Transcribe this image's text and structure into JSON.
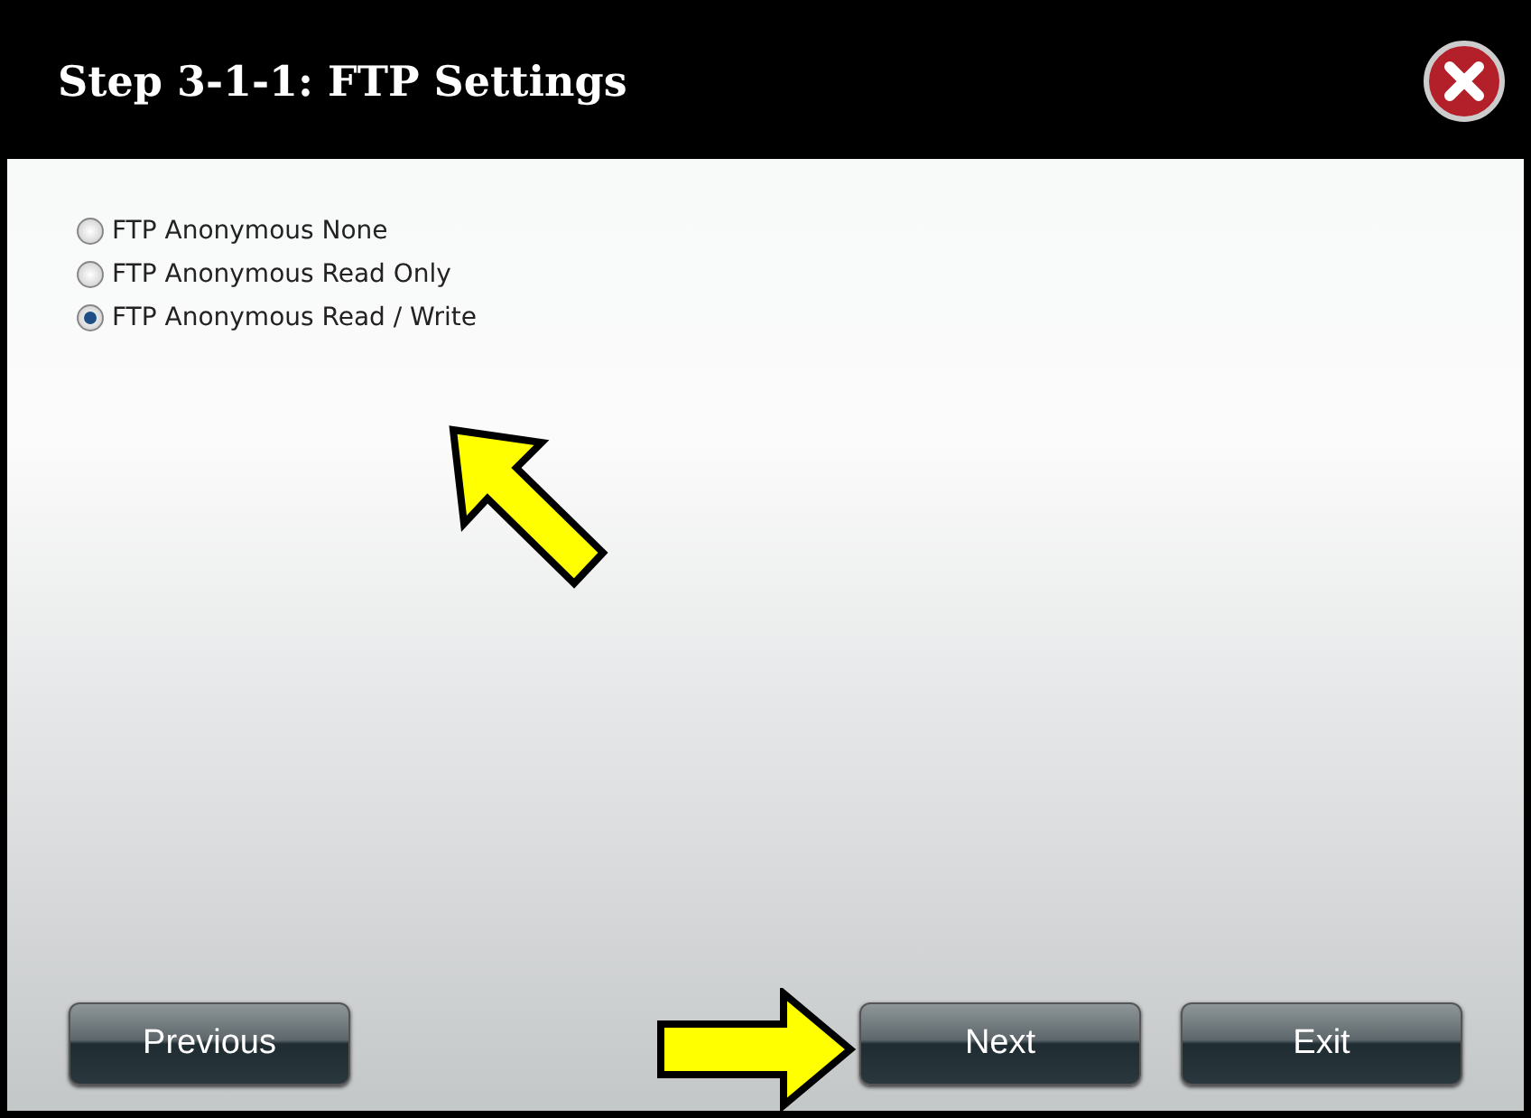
{
  "window": {
    "title": "Step 3-1-1: FTP Settings"
  },
  "options": [
    {
      "label": "FTP Anonymous None",
      "selected": false
    },
    {
      "label": "FTP Anonymous Read Only",
      "selected": false
    },
    {
      "label": "FTP Anonymous Read / Write",
      "selected": true
    }
  ],
  "buttons": [
    {
      "label": "Previous",
      "kind": "left"
    },
    {
      "label": "Next",
      "kind": "right"
    },
    {
      "label": "Exit",
      "kind": "right"
    }
  ]
}
